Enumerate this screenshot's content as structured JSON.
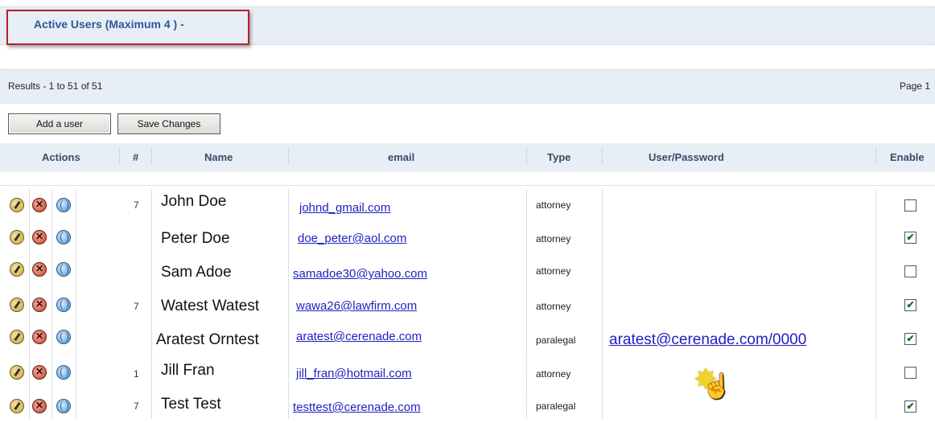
{
  "header": {
    "title": "Active Users (Maximum 4 ) -"
  },
  "results": {
    "summary": "Results - 1 to 51 of 51",
    "page": "Page 1"
  },
  "toolbar": {
    "add_label": "Add a user",
    "save_label": "Save Changes"
  },
  "table": {
    "columns": [
      "Actions",
      "#",
      "Name",
      "email",
      "Type",
      "User/Password",
      "Enable"
    ],
    "rows": [
      {
        "num": "7",
        "name": "John Doe",
        "email": "johnd_gmail.com",
        "type": "attorney",
        "credential": "",
        "enabled": false
      },
      {
        "num": "",
        "name": "Peter Doe",
        "email": "doe_peter@aol.com",
        "type": "attorney",
        "credential": "",
        "enabled": true
      },
      {
        "num": "",
        "name": "Sam Adoe",
        "email": "samadoe30@yahoo.com",
        "type": "attorney",
        "credential": "",
        "enabled": false
      },
      {
        "num": "7",
        "name": "Watest Watest",
        "email": "wawa26@lawfirm.com",
        "type": "attorney",
        "credential": "",
        "enabled": true
      },
      {
        "num": "",
        "name": "Aratest Orntest",
        "email": "aratest@cerenade.com",
        "type": "paralegal",
        "credential": "aratest@cerenade.com/0000",
        "enabled": true
      },
      {
        "num": "1",
        "name": "Jill Fran",
        "email": "jill_fran@hotmail.com",
        "type": "attorney",
        "credential": "",
        "enabled": false
      },
      {
        "num": "7",
        "name": "Test Test",
        "email": "testtest@cerenade.com",
        "type": "paralegal",
        "credential": "",
        "enabled": true
      }
    ]
  },
  "icons": {
    "edit": "edit-icon",
    "delete": "delete-icon",
    "globe": "globe-icon",
    "check": "✔"
  },
  "colors": {
    "link": "#1f1fbf",
    "header_band": "#e8eef6",
    "title": "#2d5797",
    "highlight_border": "#b4212a"
  }
}
